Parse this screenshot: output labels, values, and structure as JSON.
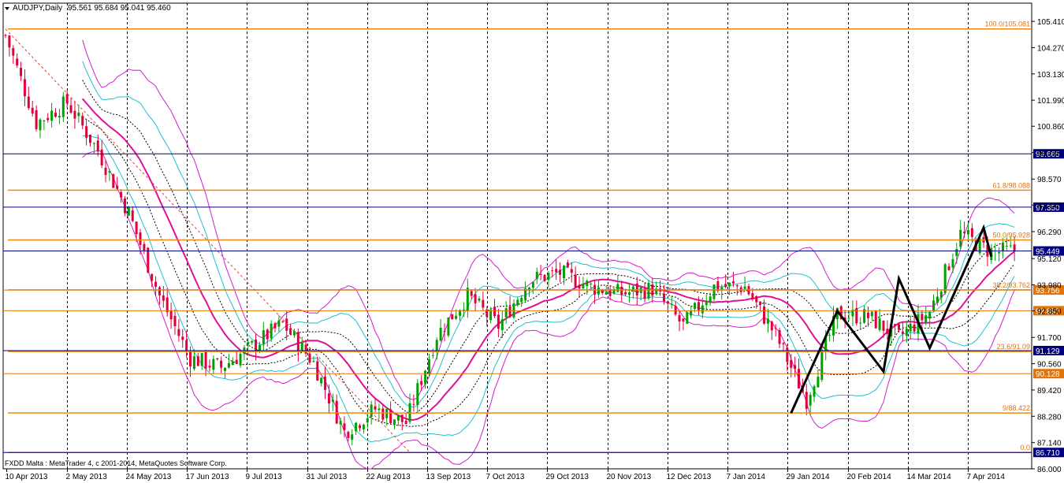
{
  "header": {
    "symbol": "AUDJPY,Daily",
    "ohlc": "95.561 95.684 95.041 95.460",
    "copyright": "FXDD Malta : MetaTrader 4, c 2001-2014, MetaQuotes Software Corp."
  },
  "chart_data": {
    "type": "candlestick",
    "ylim": [
      86.0,
      106.2
    ],
    "y_ticks": [
      "105.410",
      "104.270",
      "103.130",
      "101.990",
      "100.860",
      "99.720",
      "98.570",
      "97.440",
      "96.290",
      "95.120",
      "93.980",
      "92.850",
      "91.700",
      "90.560",
      "89.420",
      "88.280",
      "87.140",
      "86.000"
    ],
    "x_labels": [
      "10 Apr 2013",
      "2 May 2013",
      "24 May 2013",
      "17 Jun 2013",
      "9 Jul 2013",
      "31 Jul 2013",
      "22 Aug 2013",
      "13 Sep 2013",
      "7 Oct 2013",
      "29 Oct 2013",
      "20 Nov 2013",
      "12 Dec 2013",
      "7 Jan 2014",
      "29 Jan 2014",
      "20 Feb 2014",
      "14 Mar 2014",
      "7 Apr 2014"
    ],
    "fib_levels": [
      {
        "label": "100.0/105.081",
        "value": 105.081
      },
      {
        "label": "61.8/98.088",
        "value": 98.088
      },
      {
        "label": "50.0/95.928",
        "value": 95.928
      },
      {
        "label": "38.2/93.762",
        "value": 93.762
      },
      {
        "label": "23.6/91.09",
        "value": 91.09
      },
      {
        "label": "9/88.422",
        "value": 88.422
      },
      {
        "label": "0.0",
        "value": 86.71
      }
    ],
    "hlines": [
      {
        "value": 99.665,
        "label": "99.665",
        "color": "#000080"
      },
      {
        "value": 97.35,
        "label": "97.350",
        "color": "#000080"
      },
      {
        "value": 95.449,
        "label": "95.449",
        "color": "#000080"
      },
      {
        "value": 93.756,
        "label": "93.756",
        "color": "#e0740a"
      },
      {
        "value": 92.857,
        "label": "92.857",
        "color": "#e0740a"
      },
      {
        "value": 91.129,
        "label": "91.129",
        "color": "#000080"
      },
      {
        "value": 90.128,
        "label": "90.128",
        "color": "#e0740a"
      },
      {
        "value": 86.71,
        "label": "86.710",
        "color": "#000080"
      }
    ],
    "price_path": [
      [
        0,
        104.8
      ],
      [
        8,
        101.0
      ],
      [
        16,
        101.9
      ],
      [
        24,
        99.8
      ],
      [
        32,
        97.1
      ],
      [
        40,
        93.5
      ],
      [
        48,
        90.8
      ],
      [
        56,
        90.4
      ],
      [
        64,
        91.3
      ],
      [
        72,
        92.3
      ],
      [
        80,
        90.6
      ],
      [
        88,
        87.6
      ],
      [
        96,
        88.6
      ],
      [
        104,
        88.0
      ],
      [
        112,
        91.8
      ],
      [
        120,
        93.5
      ],
      [
        128,
        92.2
      ],
      [
        136,
        94.2
      ],
      [
        144,
        94.5
      ],
      [
        152,
        93.9
      ],
      [
        160,
        93.6
      ],
      [
        168,
        93.8
      ],
      [
        176,
        92.2
      ],
      [
        184,
        93.9
      ],
      [
        192,
        93.9
      ],
      [
        200,
        91.8
      ],
      [
        208,
        89.0
      ],
      [
        216,
        92.7
      ],
      [
        224,
        92.6
      ],
      [
        232,
        91.7
      ],
      [
        240,
        92.8
      ],
      [
        248,
        96.2
      ],
      [
        256,
        95.4
      ],
      [
        262,
        95.46
      ]
    ],
    "zigzag": [
      [
        204,
        88.42
      ],
      [
        216,
        92.85
      ],
      [
        228,
        90.22
      ],
      [
        232,
        94.25
      ],
      [
        240,
        91.24
      ],
      [
        254,
        96.46
      ],
      [
        256,
        95.2
      ]
    ],
    "colors": {
      "up": "#00a000",
      "down": "#e0003c",
      "ma": "#e0109a",
      "bb_outer": "#d020d0",
      "bb_inner": "#20c0d0",
      "fib": "#f08a10",
      "level_blue": "#000080"
    }
  }
}
